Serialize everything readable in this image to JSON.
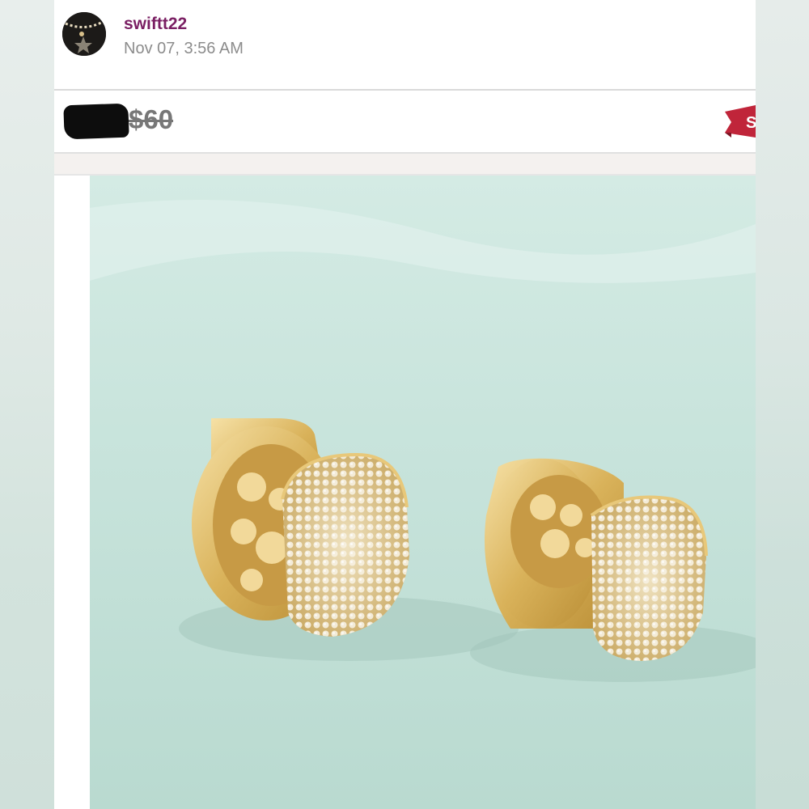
{
  "post": {
    "username": "swiftt22",
    "timestamp": "Nov 07, 3:56 AM",
    "avatar_icon": "avatar-necklace-icon"
  },
  "listing": {
    "original_price": "$60",
    "current_price_redacted": true,
    "sale_tag_text": "S"
  },
  "colors": {
    "username": "#7a1f63",
    "timestamp": "#8c8c8c",
    "strike_price": "#777777",
    "sale_tag": "#c0253a",
    "photo_background": "#cfe6df",
    "gold": "#d9b25a"
  },
  "photo": {
    "subject": "gold-pave-huggie-hoop-earrings-icon"
  }
}
